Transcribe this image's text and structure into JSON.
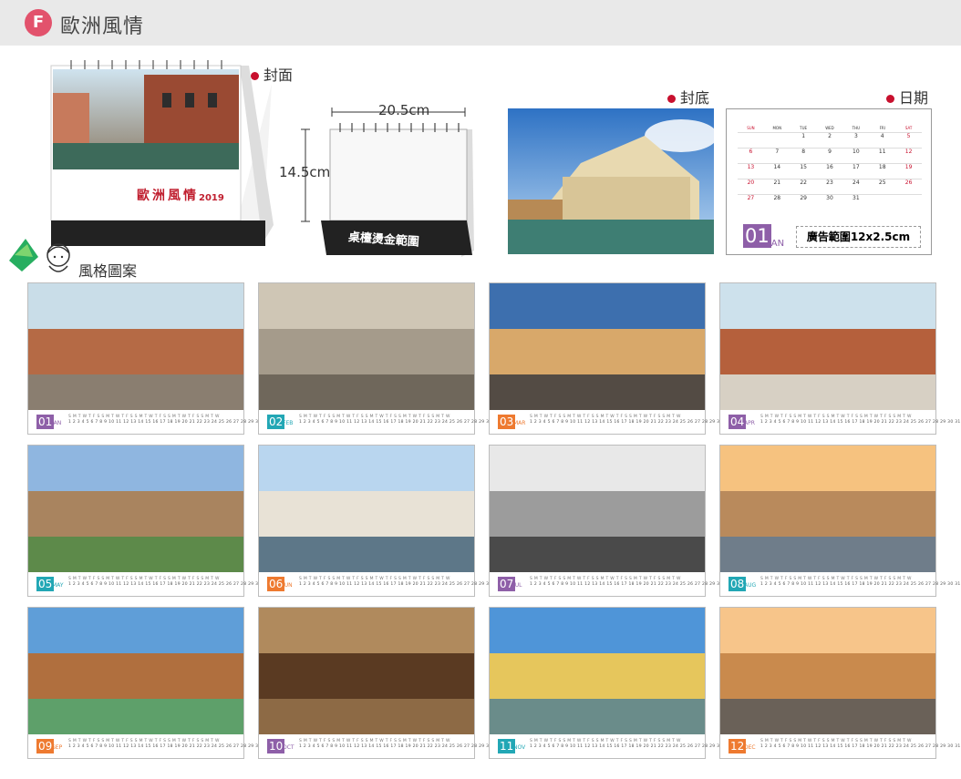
{
  "header": {
    "badge": "F",
    "title": "歐洲風情"
  },
  "labels": {
    "cover": "封面",
    "back": "封底",
    "dates": "日期",
    "style": "風格圖案"
  },
  "cover": {
    "name": "歐洲風情",
    "year": "2019"
  },
  "stand": {
    "width": "20.5cm",
    "height": "14.5cm",
    "area_label": "桌檯燙金範圍"
  },
  "date_page": {
    "month_num": "01",
    "month": "JAN",
    "ad_text": "廣告範圍12x2.5cm",
    "weekdays": [
      "SUN",
      "MON",
      "TUE",
      "WED",
      "THU",
      "FRI",
      "SAT"
    ],
    "days": [
      "",
      "",
      "1",
      "2",
      "3",
      "4",
      "5",
      "6",
      "7",
      "8",
      "9",
      "10",
      "11",
      "12",
      "13",
      "14",
      "15",
      "16",
      "17",
      "18",
      "19",
      "20",
      "21",
      "22",
      "23",
      "24",
      "25",
      "26",
      "27",
      "28",
      "29",
      "30",
      "31",
      "",
      ""
    ]
  },
  "months": [
    {
      "num": "01",
      "name": "JAN",
      "color": "#8e5fa8"
    },
    {
      "num": "02",
      "name": "FEB",
      "color": "#22a7b5"
    },
    {
      "num": "03",
      "name": "MAR",
      "color": "#ee7a30"
    },
    {
      "num": "04",
      "name": "APR",
      "color": "#8e5fa8"
    },
    {
      "num": "05",
      "name": "MAY",
      "color": "#22a7b5"
    },
    {
      "num": "06",
      "name": "JUN",
      "color": "#ee7a30"
    },
    {
      "num": "07",
      "name": "JUL",
      "color": "#8e5fa8"
    },
    {
      "num": "08",
      "name": "AUG",
      "color": "#22a7b5"
    },
    {
      "num": "09",
      "name": "SEP",
      "color": "#ee7a30"
    },
    {
      "num": "10",
      "name": "OCT",
      "color": "#8e5fa8"
    },
    {
      "num": "11",
      "name": "NOV",
      "color": "#22a7b5"
    },
    {
      "num": "12",
      "name": "DEC",
      "color": "#ee7a30"
    }
  ],
  "daystrip": "1  2  3  4  5  6  7  8  9  10 11 12 13 14 15 16 17 18 19 20 21 22 23 24 25 26 27 28 29 30 31",
  "weekstrip": "S M T W T F S S M T W T F S S M T W T F S S M T W T F S S M T W"
}
